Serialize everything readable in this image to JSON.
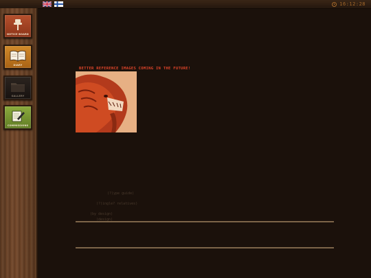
{
  "header": {
    "languages": [
      {
        "code": "en",
        "icon": "uk-flag-icon"
      },
      {
        "code": "fi",
        "icon": "finland-flag-icon"
      }
    ],
    "clock": {
      "icon": "clock-icon",
      "time": "16:12:28"
    }
  },
  "sidebar": {
    "items": [
      {
        "label": "NOTICE BOARD",
        "icon": "pushpin-icon",
        "color": "#a5411f"
      },
      {
        "label": "DIARY",
        "icon": "open-book-icon",
        "color": "#c27a1f"
      },
      {
        "label": "GALLERY",
        "icon": "folder-icon",
        "color": "#211a16"
      },
      {
        "label": "COMMISSIONS",
        "icon": "pencil-note-icon",
        "color": "#7a9833"
      }
    ]
  },
  "main": {
    "notice": "BETTER REFERENCE IMAGES COMING IN THE FUTURE!",
    "reference_image": {
      "subject": "red alien creature head illustration"
    },
    "faint_lines": [
      "(?)ype guide)",
      "(?)ingle? relatives)",
      "(by design)",
      "(design)"
    ],
    "colors": {
      "notice": "#e0452a",
      "background": "#1b110b",
      "divider": "#7d6549"
    }
  }
}
